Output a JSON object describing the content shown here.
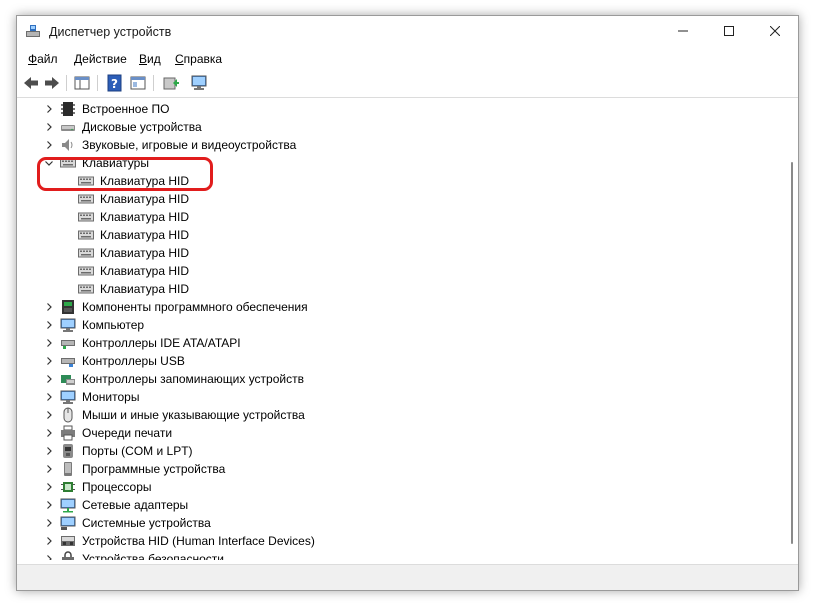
{
  "window": {
    "title": "Диспетчер устройств",
    "icon": "device-manager-icon"
  },
  "menu": [
    "Файл",
    "Действие",
    "Вид",
    "Справка"
  ],
  "toolbar": {
    "buttons": [
      "back-arrow-icon",
      "forward-arrow-icon",
      "show-hide-tree-icon",
      "help-icon",
      "properties-icon",
      "update-driver-icon",
      "scan-hardware-icon"
    ]
  },
  "tree": {
    "items": [
      {
        "label": "Встроенное ПО",
        "level": 0,
        "expander": "collapsed",
        "icon": "firmware-icon"
      },
      {
        "label": "Дисковые устройства",
        "level": 0,
        "expander": "collapsed",
        "icon": "disk-drive-icon"
      },
      {
        "label": "Звуковые, игровые и видеоустройства",
        "level": 0,
        "expander": "collapsed",
        "icon": "speaker-icon"
      },
      {
        "label": "Клавиатуры",
        "level": 0,
        "expander": "expanded",
        "icon": "keyboard-icon"
      },
      {
        "label": "Клавиатура HID",
        "level": 1,
        "expander": "none",
        "icon": "keyboard-icon"
      },
      {
        "label": "Клавиатура HID",
        "level": 1,
        "expander": "none",
        "icon": "keyboard-icon"
      },
      {
        "label": "Клавиатура HID",
        "level": 1,
        "expander": "none",
        "icon": "keyboard-icon"
      },
      {
        "label": "Клавиатура HID",
        "level": 1,
        "expander": "none",
        "icon": "keyboard-icon"
      },
      {
        "label": "Клавиатура HID",
        "level": 1,
        "expander": "none",
        "icon": "keyboard-icon"
      },
      {
        "label": "Клавиатура HID",
        "level": 1,
        "expander": "none",
        "icon": "keyboard-icon"
      },
      {
        "label": "Клавиатура HID",
        "level": 1,
        "expander": "none",
        "icon": "keyboard-icon"
      },
      {
        "label": "Компоненты программного обеспечения",
        "level": 0,
        "expander": "collapsed",
        "icon": "software-component-icon"
      },
      {
        "label": "Компьютер",
        "level": 0,
        "expander": "collapsed",
        "icon": "computer-icon"
      },
      {
        "label": "Контроллеры IDE ATA/ATAPI",
        "level": 0,
        "expander": "collapsed",
        "icon": "ide-controller-icon"
      },
      {
        "label": "Контроллеры USB",
        "level": 0,
        "expander": "collapsed",
        "icon": "usb-controller-icon"
      },
      {
        "label": "Контроллеры запоминающих устройств",
        "level": 0,
        "expander": "collapsed",
        "icon": "storage-controller-icon"
      },
      {
        "label": "Мониторы",
        "level": 0,
        "expander": "collapsed",
        "icon": "monitor-icon"
      },
      {
        "label": "Мыши и иные указывающие устройства",
        "level": 0,
        "expander": "collapsed",
        "icon": "mouse-icon"
      },
      {
        "label": "Очереди печати",
        "level": 0,
        "expander": "collapsed",
        "icon": "printer-icon"
      },
      {
        "label": "Порты (COM и LPT)",
        "level": 0,
        "expander": "collapsed",
        "icon": "port-icon"
      },
      {
        "label": "Программные устройства",
        "level": 0,
        "expander": "collapsed",
        "icon": "software-device-icon"
      },
      {
        "label": "Процессоры",
        "level": 0,
        "expander": "collapsed",
        "icon": "processor-icon"
      },
      {
        "label": "Сетевые адаптеры",
        "level": 0,
        "expander": "collapsed",
        "icon": "network-adapter-icon"
      },
      {
        "label": "Системные устройства",
        "level": 0,
        "expander": "collapsed",
        "icon": "system-device-icon"
      },
      {
        "label": "Устройства HID (Human Interface Devices)",
        "level": 0,
        "expander": "collapsed",
        "icon": "hid-device-icon"
      },
      {
        "label": "Устройства безопасности",
        "level": 0,
        "expander": "collapsed",
        "icon": "security-device-icon"
      }
    ]
  },
  "highlight": {
    "color": "#e11d1d",
    "target": "Клавиатура HID"
  }
}
